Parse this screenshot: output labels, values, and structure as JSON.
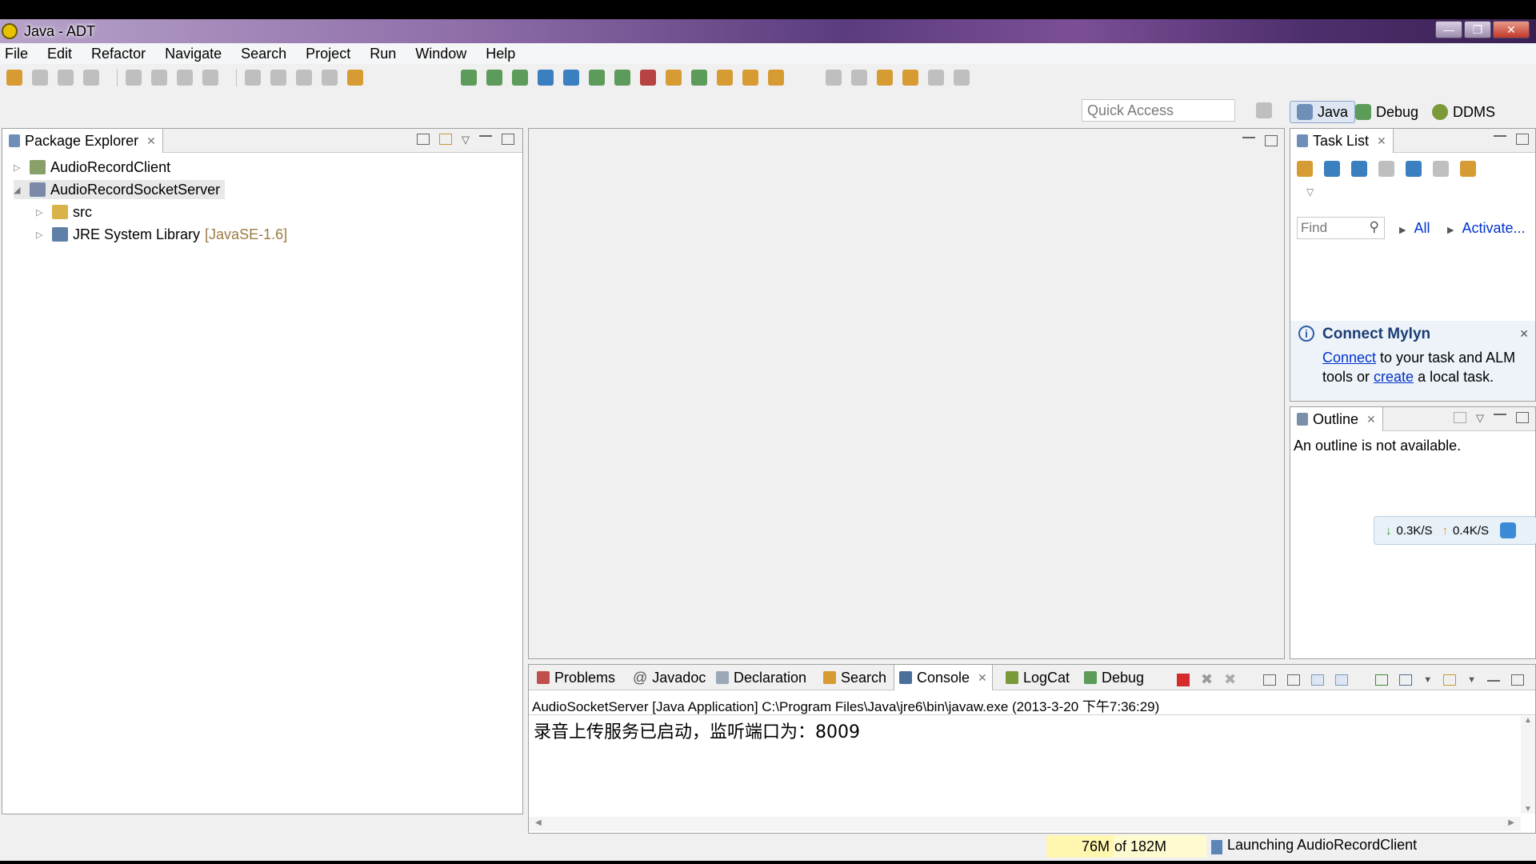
{
  "window": {
    "title": "Java - ADT"
  },
  "menu": [
    "File",
    "Edit",
    "Refactor",
    "Navigate",
    "Search",
    "Project",
    "Run",
    "Window",
    "Help"
  ],
  "perspective": {
    "quick_access_placeholder": "Quick Access",
    "java": "Java",
    "debug": "Debug",
    "ddms": "DDMS"
  },
  "package_explorer": {
    "tab": "Package Explorer",
    "projects": [
      {
        "name": "AudioRecordClient",
        "expanded": false
      },
      {
        "name": "AudioRecordSocketServer",
        "expanded": true
      }
    ],
    "children": [
      {
        "name": "src",
        "suffix": ""
      },
      {
        "name": "JRE System Library",
        "suffix": "[JavaSE-1.6]"
      }
    ]
  },
  "task_list": {
    "tab": "Task List",
    "find_placeholder": "Find",
    "all": "All",
    "activate": "Activate..."
  },
  "mylyn": {
    "title": "Connect Mylyn",
    "connect_link": "Connect",
    "text1": " to your task and ALM",
    "text2_pre": "tools or ",
    "create_link": "create",
    "text2_post": " a local task."
  },
  "outline": {
    "tab": "Outline",
    "message": "An outline is not available."
  },
  "net_speed": {
    "down": "0.3K/S",
    "up": "0.4K/S"
  },
  "bottom_tabs": [
    "Problems",
    "Javadoc",
    "Declaration",
    "Search",
    "Console",
    "LogCat",
    "Debug"
  ],
  "console": {
    "header": "AudioSocketServer [Java Application] C:\\Program Files\\Java\\jre6\\bin\\javaw.exe (2013-3-20 下午7:36:29)",
    "output": "录音上传服务已启动，监听端口为：8009"
  },
  "status": {
    "memory_used": "76M",
    "memory_total": "of 182M",
    "memory_fraction": 0.42,
    "progress": "Launching AudioRecordClient"
  }
}
